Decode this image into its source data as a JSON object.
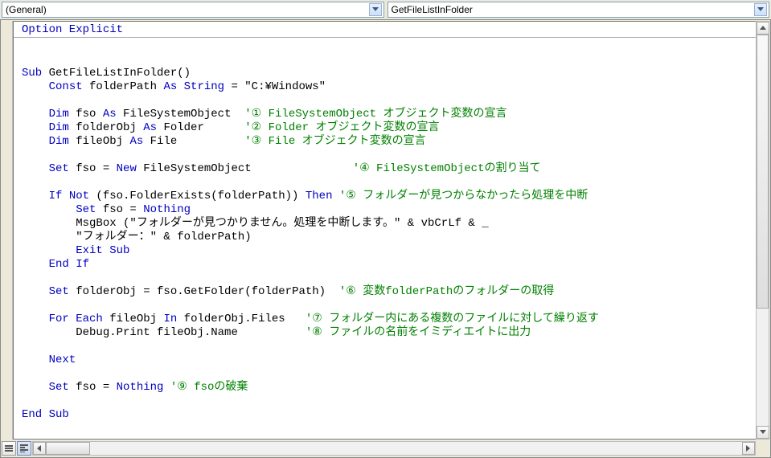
{
  "dropdowns": {
    "object": "(General)",
    "procedure": "GetFileListInFolder"
  },
  "code": {
    "declaration": [
      [
        {
          "t": "kw",
          "v": "Option Explicit"
        }
      ]
    ],
    "body": [
      [
        {
          "t": "",
          "v": ""
        }
      ],
      [
        {
          "t": "",
          "v": ""
        }
      ],
      [
        {
          "t": "kw",
          "v": "Sub "
        },
        {
          "t": "",
          "v": "GetFileListInFolder()"
        }
      ],
      [
        {
          "t": "",
          "v": "    "
        },
        {
          "t": "kw",
          "v": "Const "
        },
        {
          "t": "",
          "v": "folderPath "
        },
        {
          "t": "kw",
          "v": "As String "
        },
        {
          "t": "",
          "v": "= \"C:¥Windows\""
        }
      ],
      [
        {
          "t": "",
          "v": ""
        }
      ],
      [
        {
          "t": "",
          "v": "    "
        },
        {
          "t": "kw",
          "v": "Dim "
        },
        {
          "t": "",
          "v": "fso "
        },
        {
          "t": "kw",
          "v": "As "
        },
        {
          "t": "",
          "v": "FileSystemObject  "
        },
        {
          "t": "cm",
          "v": "'① FileSystemObject オブジェクト変数の宣言"
        }
      ],
      [
        {
          "t": "",
          "v": "    "
        },
        {
          "t": "kw",
          "v": "Dim "
        },
        {
          "t": "",
          "v": "folderObj "
        },
        {
          "t": "kw",
          "v": "As "
        },
        {
          "t": "",
          "v": "Folder      "
        },
        {
          "t": "cm",
          "v": "'② Folder オブジェクト変数の宣言"
        }
      ],
      [
        {
          "t": "",
          "v": "    "
        },
        {
          "t": "kw",
          "v": "Dim "
        },
        {
          "t": "",
          "v": "fileObj "
        },
        {
          "t": "kw",
          "v": "As "
        },
        {
          "t": "",
          "v": "File          "
        },
        {
          "t": "cm",
          "v": "'③ File オブジェクト変数の宣言"
        }
      ],
      [
        {
          "t": "",
          "v": ""
        }
      ],
      [
        {
          "t": "",
          "v": "    "
        },
        {
          "t": "kw",
          "v": "Set "
        },
        {
          "t": "",
          "v": "fso = "
        },
        {
          "t": "kw",
          "v": "New "
        },
        {
          "t": "",
          "v": "FileSystemObject               "
        },
        {
          "t": "cm",
          "v": "'④ FileSystemObjectの割り当て"
        }
      ],
      [
        {
          "t": "",
          "v": ""
        }
      ],
      [
        {
          "t": "",
          "v": "    "
        },
        {
          "t": "kw",
          "v": "If Not "
        },
        {
          "t": "",
          "v": "(fso.FolderExists(folderPath)) "
        },
        {
          "t": "kw",
          "v": "Then "
        },
        {
          "t": "cm",
          "v": "'⑤ フォルダーが見つからなかったら処理を中断"
        }
      ],
      [
        {
          "t": "",
          "v": "        "
        },
        {
          "t": "kw",
          "v": "Set "
        },
        {
          "t": "",
          "v": "fso = "
        },
        {
          "t": "kw",
          "v": "Nothing"
        }
      ],
      [
        {
          "t": "",
          "v": "        MsgBox (\"フォルダーが見つかりません。処理を中断します。\" & vbCrLf & _"
        }
      ],
      [
        {
          "t": "",
          "v": "        \"フォルダー：\" & folderPath)"
        }
      ],
      [
        {
          "t": "",
          "v": "        "
        },
        {
          "t": "kw",
          "v": "Exit Sub"
        }
      ],
      [
        {
          "t": "",
          "v": "    "
        },
        {
          "t": "kw",
          "v": "End If"
        }
      ],
      [
        {
          "t": "",
          "v": ""
        }
      ],
      [
        {
          "t": "",
          "v": "    "
        },
        {
          "t": "kw",
          "v": "Set "
        },
        {
          "t": "",
          "v": "folderObj = fso.GetFolder(folderPath)  "
        },
        {
          "t": "cm",
          "v": "'⑥ 変数folderPathのフォルダーの取得"
        }
      ],
      [
        {
          "t": "",
          "v": ""
        }
      ],
      [
        {
          "t": "",
          "v": "    "
        },
        {
          "t": "kw",
          "v": "For Each "
        },
        {
          "t": "",
          "v": "fileObj "
        },
        {
          "t": "kw",
          "v": "In "
        },
        {
          "t": "",
          "v": "folderObj.Files   "
        },
        {
          "t": "cm",
          "v": "'⑦ フォルダー内にある複数のファイルに対して繰り返す"
        }
      ],
      [
        {
          "t": "",
          "v": "        Debug.Print fileObj.Name          "
        },
        {
          "t": "cm",
          "v": "'⑧ ファイルの名前をイミディエイトに出力"
        }
      ],
      [
        {
          "t": "",
          "v": ""
        }
      ],
      [
        {
          "t": "",
          "v": "    "
        },
        {
          "t": "kw",
          "v": "Next"
        }
      ],
      [
        {
          "t": "",
          "v": ""
        }
      ],
      [
        {
          "t": "",
          "v": "    "
        },
        {
          "t": "kw",
          "v": "Set "
        },
        {
          "t": "",
          "v": "fso = "
        },
        {
          "t": "kw",
          "v": "Nothing "
        },
        {
          "t": "cm",
          "v": "'⑨ fsoの破棄"
        }
      ],
      [
        {
          "t": "",
          "v": ""
        }
      ],
      [
        {
          "t": "kw",
          "v": "End Sub"
        }
      ]
    ]
  }
}
